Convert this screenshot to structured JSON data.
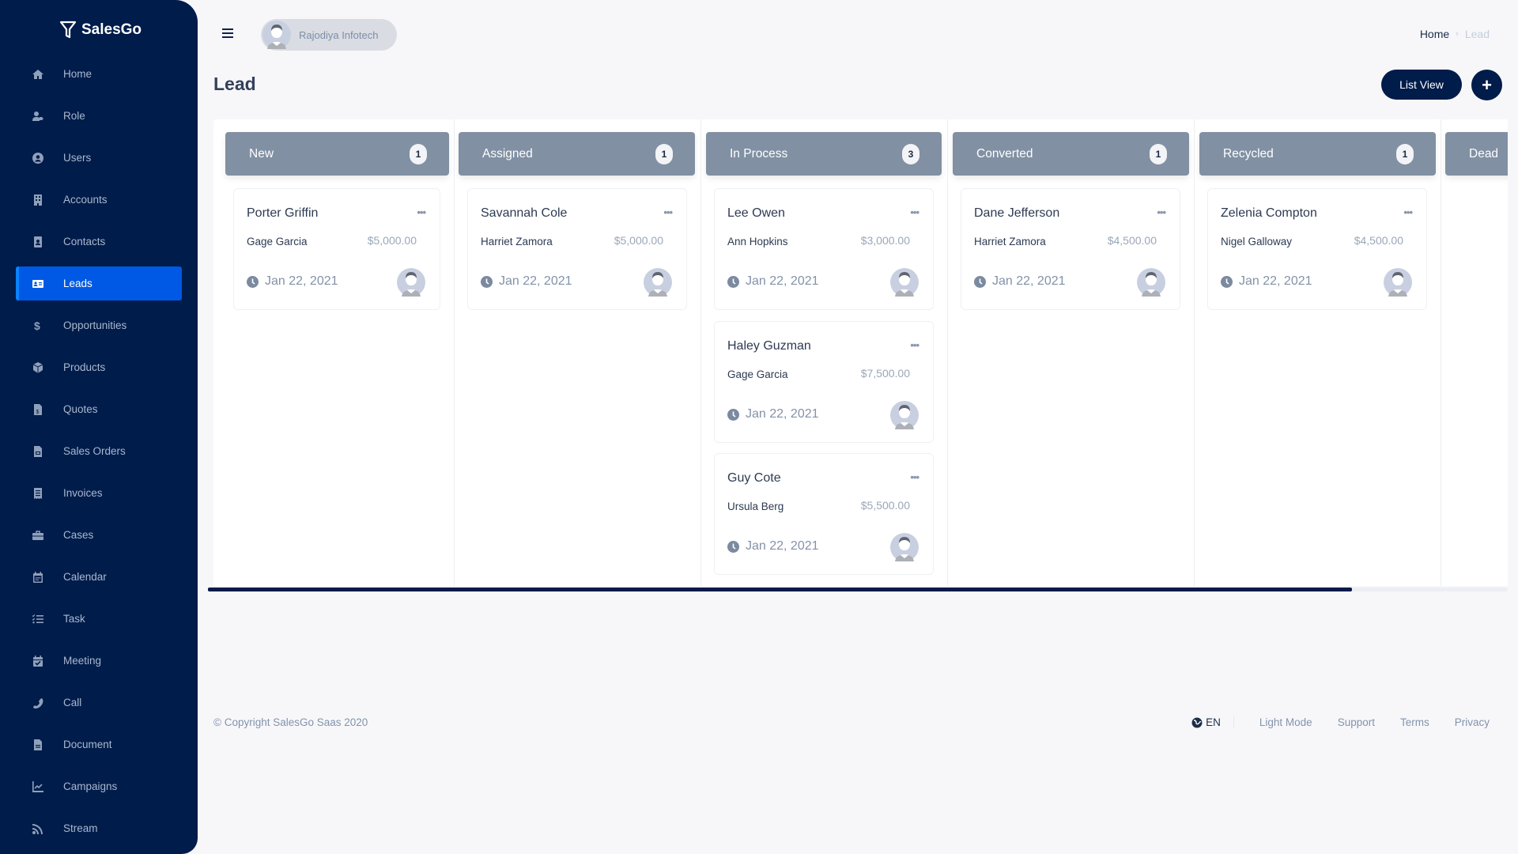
{
  "app": {
    "name": "SalesGo"
  },
  "sidebar": {
    "items": [
      {
        "label": "Home",
        "icon": "home-icon",
        "active": false
      },
      {
        "label": "Role",
        "icon": "user-tag-icon",
        "active": false
      },
      {
        "label": "Users",
        "icon": "user-circle-icon",
        "active": false
      },
      {
        "label": "Accounts",
        "icon": "building-icon",
        "active": false
      },
      {
        "label": "Contacts",
        "icon": "id-badge-icon",
        "active": false
      },
      {
        "label": "Leads",
        "icon": "id-card-icon",
        "active": true
      },
      {
        "label": "Opportunities",
        "icon": "dollar-icon",
        "active": false
      },
      {
        "label": "Products",
        "icon": "box-icon",
        "active": false
      },
      {
        "label": "Quotes",
        "icon": "file-invoice-dollar-icon",
        "active": false
      },
      {
        "label": "Sales Orders",
        "icon": "file-order-icon",
        "active": false
      },
      {
        "label": "Invoices",
        "icon": "receipt-icon",
        "active": false
      },
      {
        "label": "Cases",
        "icon": "briefcase-icon",
        "active": false
      },
      {
        "label": "Calendar",
        "icon": "calendar-icon",
        "active": false
      },
      {
        "label": "Task",
        "icon": "tasks-icon",
        "active": false
      },
      {
        "label": "Meeting",
        "icon": "calendar-check-icon",
        "active": false
      },
      {
        "label": "Call",
        "icon": "phone-icon",
        "active": false
      },
      {
        "label": "Document",
        "icon": "file-alt-icon",
        "active": false
      },
      {
        "label": "Campaigns",
        "icon": "chart-line-icon",
        "active": false
      },
      {
        "label": "Stream",
        "icon": "rss-icon",
        "active": false
      }
    ]
  },
  "header": {
    "organization": "Rajodiya Infotech",
    "breadcrumb": {
      "home": "Home",
      "separator": "›",
      "current": "Lead"
    }
  },
  "page": {
    "title": "Lead",
    "list_view_label": "List View",
    "add_label": "+"
  },
  "board": {
    "columns": [
      {
        "title": "New",
        "count": "1",
        "cards": [
          {
            "name": "Porter Griffin",
            "company": "Gage Garcia",
            "amount": "$5,000.00",
            "date": "Jan 22, 2021"
          }
        ]
      },
      {
        "title": "Assigned",
        "count": "1",
        "cards": [
          {
            "name": "Savannah Cole",
            "company": "Harriet Zamora",
            "amount": "$5,000.00",
            "date": "Jan 22, 2021"
          }
        ]
      },
      {
        "title": "In Process",
        "count": "3",
        "cards": [
          {
            "name": "Lee Owen",
            "company": "Ann Hopkins",
            "amount": "$3,000.00",
            "date": "Jan 22, 2021"
          },
          {
            "name": "Haley Guzman",
            "company": "Gage Garcia",
            "amount": "$7,500.00",
            "date": "Jan 22, 2021"
          },
          {
            "name": "Guy Cote",
            "company": "Ursula Berg",
            "amount": "$5,500.00",
            "date": "Jan 22, 2021"
          }
        ]
      },
      {
        "title": "Converted",
        "count": "1",
        "cards": [
          {
            "name": "Dane Jefferson",
            "company": "Harriet Zamora",
            "amount": "$4,500.00",
            "date": "Jan 22, 2021"
          }
        ]
      },
      {
        "title": "Recycled",
        "count": "1",
        "cards": [
          {
            "name": "Zelenia Compton",
            "company": "Nigel Galloway",
            "amount": "$4,500.00",
            "date": "Jan 22, 2021"
          }
        ]
      },
      {
        "title": "Dead",
        "count": "",
        "cards": []
      }
    ],
    "scroll_fraction_visible": 0.88,
    "more_label": "•••"
  },
  "footer": {
    "copyright": "© Copyright SalesGo Saas 2020",
    "language": "EN",
    "links": [
      "Light Mode",
      "Support",
      "Terms",
      "Privacy"
    ]
  },
  "colors": {
    "sidebar_bg": "#001c4a",
    "accent": "#0059e4",
    "column_header": "#8190a3"
  }
}
